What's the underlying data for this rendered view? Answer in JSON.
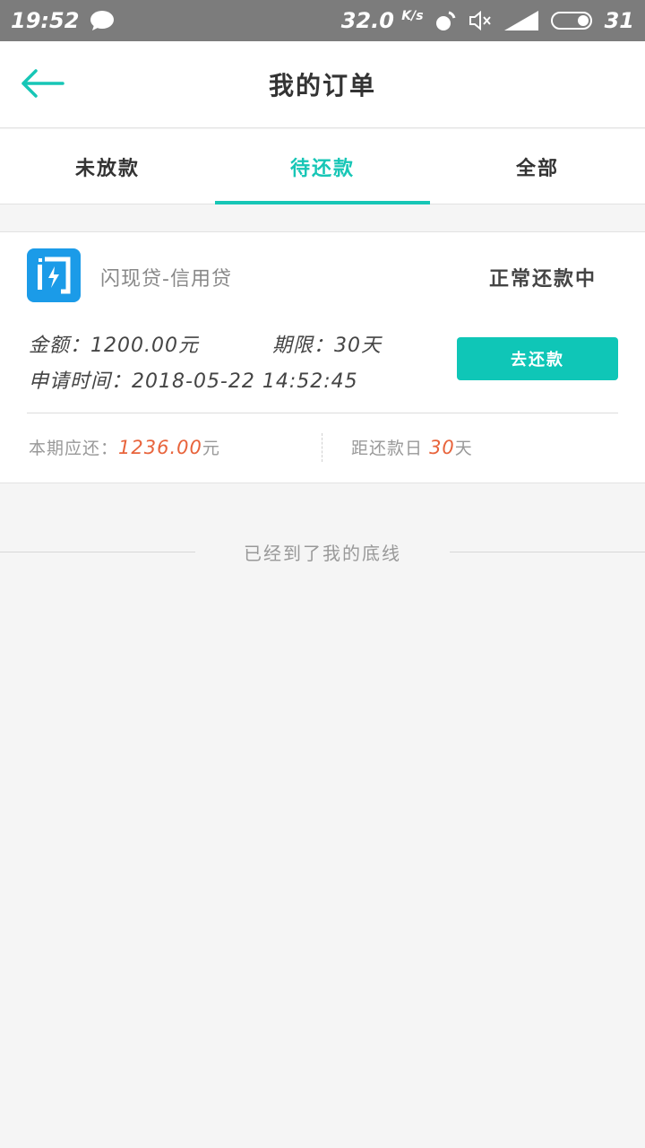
{
  "status_bar": {
    "time": "19:52",
    "speed_value": "32.0",
    "speed_unit": "K/s",
    "battery": "31",
    "icons": [
      "chat-bubble-icon",
      "hotspot-icon",
      "mute-icon",
      "4g-signal-icon",
      "battery-icon"
    ]
  },
  "header": {
    "title": "我的订单"
  },
  "tabs": [
    {
      "label": "未放款",
      "active": false
    },
    {
      "label": "待还款",
      "active": true
    },
    {
      "label": "全部",
      "active": false
    }
  ],
  "order": {
    "product_name": "闪现贷-信用贷",
    "status": "正常还款中",
    "amount_label": "金额：",
    "amount_value": "1200.00元",
    "term_label": "期限：",
    "term_value": "30天",
    "apply_time_label": "申请时间：",
    "apply_time_value": "2018-05-22 14:52:45",
    "repay_button": "去还款",
    "current_due_label": "本期应还：",
    "current_due_value": "1236.00",
    "current_due_unit": "元",
    "days_left_label": "距还款日",
    "days_left_value": "30",
    "days_left_unit": "天"
  },
  "footer_note": "已经到了我的底线",
  "colors": {
    "accent": "#17c6b6",
    "button": "#0fc6b7",
    "highlight": "#e8643c",
    "logo": "#1b9be8",
    "status_bar": "#7c7c7c"
  }
}
